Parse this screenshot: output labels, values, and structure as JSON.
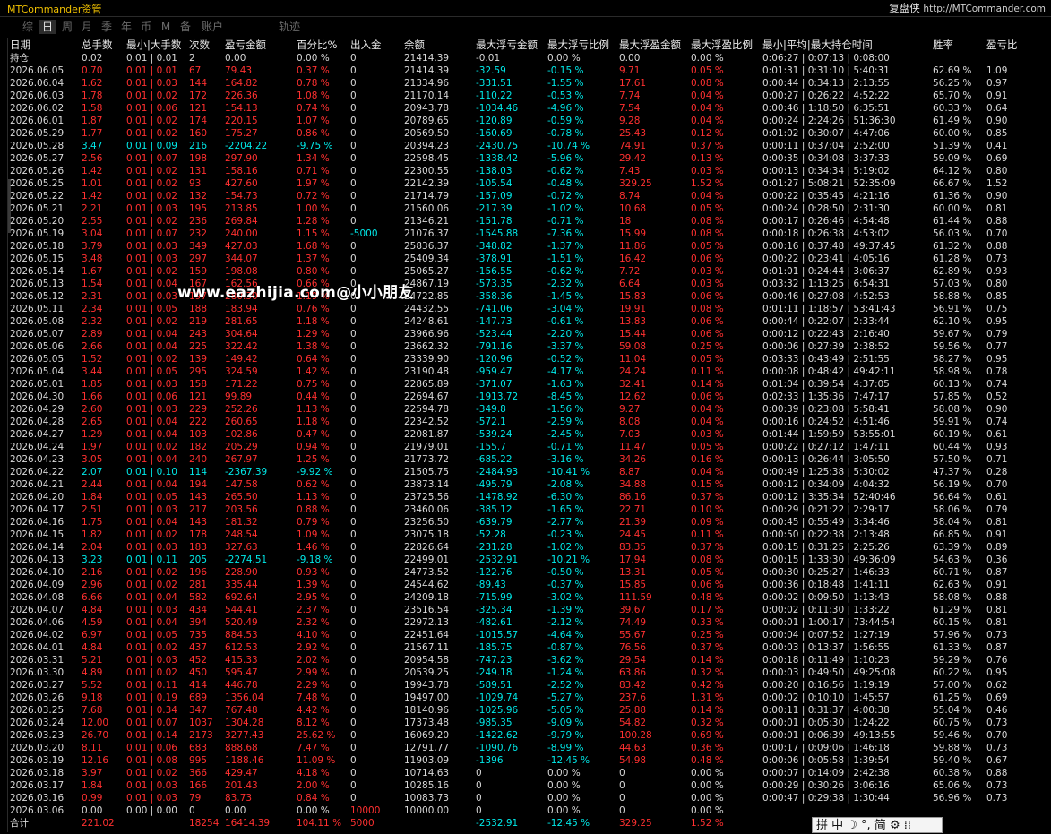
{
  "app": {
    "title": "MTCommander资管"
  },
  "brand": {
    "name": "复盘侠",
    "url": "http://MTCommander.com"
  },
  "tabs": [
    "综",
    "日",
    "周",
    "月",
    "季",
    "年",
    "币",
    "M",
    "备",
    "账户",
    "轨迹"
  ],
  "active_tab": "日",
  "headers": [
    "日期",
    "总手数",
    "最小|大手数",
    "次数",
    "盈亏金额",
    "百分比%",
    "出入金",
    "余额",
    "最大浮亏金额",
    "最大浮亏比例",
    "最大浮盈金额",
    "最大浮盈比例",
    "最小|平均|最大持仓时间",
    "胜率",
    "盈亏比"
  ],
  "holding": [
    "持仓",
    "0.02",
    "0.01 | 0.01",
    "2",
    "0.00",
    "0.00 %",
    "0",
    "21414.39",
    "-0.01",
    "0.00 %",
    "0.00",
    "0.00 %",
    "0:06:27 | 0:07:13 | 0:08:00",
    "",
    ""
  ],
  "rows": [
    [
      "2026.06.05",
      "0.70",
      "0.01 | 0.01",
      "67",
      "79.43",
      "0.37 %",
      "0",
      "21414.39",
      "-32.59",
      "-0.15 %",
      "9.71",
      "0.05 %",
      "0:01:31 | 0:31:10 | 5:40:31",
      "62.69 %",
      "1.09"
    ],
    [
      "2026.06.04",
      "1.62",
      "0.01 | 0.03",
      "144",
      "164.82",
      "0.78 %",
      "0",
      "21334.96",
      "-331.51",
      "-1.55 %",
      "17.61",
      "0.08 %",
      "0:00:44 | 0:34:13 | 2:13:55",
      "56.25 %",
      "0.97"
    ],
    [
      "2026.06.03",
      "1.78",
      "0.01 | 0.02",
      "172",
      "226.36",
      "1.08 %",
      "0",
      "21170.14",
      "-110.22",
      "-0.53 %",
      "7.74",
      "0.04 %",
      "0:00:27 | 0:26:22 | 4:52:22",
      "65.70 %",
      "0.91"
    ],
    [
      "2026.06.02",
      "1.58",
      "0.01 | 0.06",
      "121",
      "154.13",
      "0.74 %",
      "0",
      "20943.78",
      "-1034.46",
      "-4.96 %",
      "7.54",
      "0.04 %",
      "0:00:46 | 1:18:50 | 6:35:51",
      "60.33 %",
      "0.64"
    ],
    [
      "2026.06.01",
      "1.87",
      "0.01 | 0.02",
      "174",
      "220.15",
      "1.07 %",
      "0",
      "20789.65",
      "-120.89",
      "-0.59 %",
      "9.28",
      "0.04 %",
      "0:00:24 | 2:24:26 | 51:36:30",
      "61.49 %",
      "0.90"
    ],
    [
      "2026.05.29",
      "1.77",
      "0.01 | 0.02",
      "160",
      "175.27",
      "0.86 %",
      "0",
      "20569.50",
      "-160.69",
      "-0.78 %",
      "25.43",
      "0.12 %",
      "0:01:02 | 0:30:07 | 4:47:06",
      "60.00 %",
      "0.85"
    ],
    [
      "2026.05.28",
      "3.47",
      "0.01 | 0.09",
      "216",
      "-2204.22",
      "-9.75 %",
      "0",
      "20394.23",
      "-2430.75",
      "-10.74 %",
      "74.91",
      "0.37 %",
      "0:00:11 | 0:37:04 | 2:52:00",
      "51.39 %",
      "0.41"
    ],
    [
      "2026.05.27",
      "2.56",
      "0.01 | 0.07",
      "198",
      "297.90",
      "1.34 %",
      "0",
      "22598.45",
      "-1338.42",
      "-5.96 %",
      "29.42",
      "0.13 %",
      "0:00:35 | 0:34:08 | 3:37:33",
      "59.09 %",
      "0.69"
    ],
    [
      "2026.05.26",
      "1.42",
      "0.01 | 0.02",
      "131",
      "158.16",
      "0.71 %",
      "0",
      "22300.55",
      "-138.03",
      "-0.62 %",
      "7.43",
      "0.03 %",
      "0:00:13 | 0:34:34 | 5:19:02",
      "64.12 %",
      "0.80"
    ],
    [
      "2026.05.25",
      "1.01",
      "0.01 | 0.02",
      "93",
      "427.60",
      "1.97 %",
      "0",
      "22142.39",
      "-105.54",
      "-0.48 %",
      "329.25",
      "1.52 %",
      "0:01:27 | 5:08:21 | 52:35:09",
      "66.67 %",
      "1.52"
    ],
    [
      "2026.05.22",
      "1.42",
      "0.01 | 0.02",
      "132",
      "154.73",
      "0.72 %",
      "0",
      "21714.79",
      "-157.09",
      "-0.72 %",
      "8.74",
      "0.04 %",
      "0:00:22 | 0:35:45 | 4:21:16",
      "61.36 %",
      "0.90"
    ],
    [
      "2026.05.21",
      "2.21",
      "0.01 | 0.03",
      "195",
      "213.85",
      "1.00 %",
      "0",
      "21560.06",
      "-217.39",
      "-1.02 %",
      "10.68",
      "0.05 %",
      "0:00:24 | 0:28:50 | 2:31:30",
      "60.00 %",
      "0.81"
    ],
    [
      "2026.05.20",
      "2.55",
      "0.01 | 0.02",
      "236",
      "269.84",
      "1.28 %",
      "0",
      "21346.21",
      "-151.78",
      "-0.71 %",
      "18",
      "0.08 %",
      "0:00:17 | 0:26:46 | 4:54:48",
      "61.44 %",
      "0.88"
    ],
    [
      "2026.05.19",
      "3.04",
      "0.01 | 0.07",
      "232",
      "240.00",
      "1.15 %",
      "-5000",
      "21076.37",
      "-1545.88",
      "-7.36 %",
      "15.99",
      "0.08 %",
      "0:00:18 | 0:26:38 | 4:53:02",
      "56.03 %",
      "0.70"
    ],
    [
      "2026.05.18",
      "3.79",
      "0.01 | 0.03",
      "349",
      "427.03",
      "1.68 %",
      "0",
      "25836.37",
      "-348.82",
      "-1.37 %",
      "11.86",
      "0.05 %",
      "0:00:16 | 0:37:48 | 49:37:45",
      "61.32 %",
      "0.88"
    ],
    [
      "2026.05.15",
      "3.48",
      "0.01 | 0.03",
      "297",
      "344.07",
      "1.37 %",
      "0",
      "25409.34",
      "-378.91",
      "-1.51 %",
      "16.42",
      "0.06 %",
      "0:00:22 | 0:23:41 | 4:05:16",
      "61.28 %",
      "0.73"
    ],
    [
      "2026.05.14",
      "1.67",
      "0.01 | 0.02",
      "159",
      "198.08",
      "0.80 %",
      "0",
      "25065.27",
      "-156.55",
      "-0.62 %",
      "7.72",
      "0.03 %",
      "0:01:01 | 0:24:44 | 3:06:37",
      "62.89 %",
      "0.93"
    ],
    [
      "2026.05.13",
      "1.54",
      "0.01 | 0.04",
      "167",
      "162.56",
      "0.66 %",
      "0",
      "24867.19",
      "-573.35",
      "-2.32 %",
      "6.64",
      "0.03 %",
      "0:03:32 | 1:13:25 | 6:54:31",
      "57.03 %",
      "0.80"
    ],
    [
      "2026.05.12",
      "2.31",
      "0.01 | 0.03",
      "197",
      "280.30",
      "1.19 %",
      "0",
      "24722.85",
      "-358.36",
      "-1.45 %",
      "15.83",
      "0.06 %",
      "0:00:46 | 0:27:08 | 4:52:53",
      "58.88 %",
      "0.85"
    ],
    [
      "2026.05.11",
      "2.34",
      "0.01 | 0.05",
      "188",
      "183.94",
      "0.76 %",
      "0",
      "24432.55",
      "-741.06",
      "-3.04 %",
      "19.91",
      "0.08 %",
      "0:01:11 | 1:18:57 | 53:41:43",
      "56.91 %",
      "0.75"
    ],
    [
      "2026.05.08",
      "2.32",
      "0.01 | 0.02",
      "219",
      "281.65",
      "1.18 %",
      "0",
      "24248.61",
      "-147.73",
      "-0.61 %",
      "13.83",
      "0.06 %",
      "0:00:44 | 0:22:07 | 2:33:44",
      "62.10 %",
      "0.95"
    ],
    [
      "2026.05.07",
      "2.89",
      "0.01 | 0.04",
      "243",
      "304.64",
      "1.29 %",
      "0",
      "23966.96",
      "-523.44",
      "-2.20 %",
      "15.44",
      "0.06 %",
      "0:00:12 | 0:22:43 | 2:16:40",
      "59.67 %",
      "0.79"
    ],
    [
      "2026.05.06",
      "2.66",
      "0.01 | 0.04",
      "225",
      "322.42",
      "1.38 %",
      "0",
      "23662.32",
      "-791.16",
      "-3.37 %",
      "59.08",
      "0.25 %",
      "0:00:06 | 0:27:39 | 2:38:52",
      "59.56 %",
      "0.77"
    ],
    [
      "2026.05.05",
      "1.52",
      "0.01 | 0.02",
      "139",
      "149.42",
      "0.64 %",
      "0",
      "23339.90",
      "-120.96",
      "-0.52 %",
      "11.04",
      "0.05 %",
      "0:03:33 | 0:43:49 | 2:51:55",
      "58.27 %",
      "0.95"
    ],
    [
      "2026.05.04",
      "3.44",
      "0.01 | 0.05",
      "295",
      "324.59",
      "1.42 %",
      "0",
      "23190.48",
      "-959.47",
      "-4.17 %",
      "24.24",
      "0.11 %",
      "0:00:08 | 0:48:42 | 49:42:11",
      "58.98 %",
      "0.78"
    ],
    [
      "2026.05.01",
      "1.85",
      "0.01 | 0.03",
      "158",
      "171.22",
      "0.75 %",
      "0",
      "22865.89",
      "-371.07",
      "-1.63 %",
      "32.41",
      "0.14 %",
      "0:01:04 | 0:39:54 | 4:37:05",
      "60.13 %",
      "0.74"
    ],
    [
      "2026.04.30",
      "1.66",
      "0.01 | 0.06",
      "121",
      "99.89",
      "0.44 %",
      "0",
      "22694.67",
      "-1913.72",
      "-8.45 %",
      "12.62",
      "0.06 %",
      "0:02:33 | 1:35:36 | 7:47:17",
      "57.85 %",
      "0.52"
    ],
    [
      "2026.04.29",
      "2.60",
      "0.01 | 0.03",
      "229",
      "252.26",
      "1.13 %",
      "0",
      "22594.78",
      "-349.8",
      "-1.56 %",
      "9.27",
      "0.04 %",
      "0:00:39 | 0:23:08 | 5:58:41",
      "58.08 %",
      "0.90"
    ],
    [
      "2026.04.28",
      "2.65",
      "0.01 | 0.04",
      "222",
      "260.65",
      "1.18 %",
      "0",
      "22342.52",
      "-572.1",
      "-2.59 %",
      "8.08",
      "0.04 %",
      "0:00:16 | 0:24:52 | 4:51:46",
      "59.91 %",
      "0.74"
    ],
    [
      "2026.04.27",
      "1.29",
      "0.01 | 0.04",
      "103",
      "102.86",
      "0.47 %",
      "0",
      "22081.87",
      "-539.24",
      "-2.45 %",
      "7.03",
      "0.03 %",
      "0:01:44 | 1:59:59 | 53:55:01",
      "60.19 %",
      "0.61"
    ],
    [
      "2026.04.24",
      "1.97",
      "0.01 | 0.02",
      "182",
      "205.29",
      "0.94 %",
      "0",
      "21979.01",
      "-155.7",
      "-0.71 %",
      "11.47",
      "0.05 %",
      "0:00:22 | 0:27:12 | 1:47:11",
      "60.44 %",
      "0.93"
    ],
    [
      "2026.04.23",
      "3.05",
      "0.01 | 0.04",
      "240",
      "267.97",
      "1.25 %",
      "0",
      "21773.72",
      "-685.22",
      "-3.16 %",
      "34.26",
      "0.16 %",
      "0:00:13 | 0:26:44 | 3:05:50",
      "57.50 %",
      "0.71"
    ],
    [
      "2026.04.22",
      "2.07",
      "0.01 | 0.10",
      "114",
      "-2367.39",
      "-9.92 %",
      "0",
      "21505.75",
      "-2484.93",
      "-10.41 %",
      "8.87",
      "0.04 %",
      "0:00:49 | 1:25:38 | 5:30:02",
      "47.37 %",
      "0.28"
    ],
    [
      "2026.04.21",
      "2.44",
      "0.01 | 0.04",
      "194",
      "147.58",
      "0.62 %",
      "0",
      "23873.14",
      "-495.79",
      "-2.08 %",
      "34.88",
      "0.15 %",
      "0:00:12 | 0:34:09 | 4:04:32",
      "56.19 %",
      "0.70"
    ],
    [
      "2026.04.20",
      "1.84",
      "0.01 | 0.05",
      "143",
      "265.50",
      "1.13 %",
      "0",
      "23725.56",
      "-1478.92",
      "-6.30 %",
      "86.16",
      "0.37 %",
      "0:00:12 | 3:35:34 | 52:40:46",
      "56.64 %",
      "0.61"
    ],
    [
      "2026.04.17",
      "2.51",
      "0.01 | 0.03",
      "217",
      "203.56",
      "0.88 %",
      "0",
      "23460.06",
      "-385.12",
      "-1.65 %",
      "22.71",
      "0.10 %",
      "0:00:29 | 0:21:22 | 2:29:17",
      "58.06 %",
      "0.79"
    ],
    [
      "2026.04.16",
      "1.75",
      "0.01 | 0.04",
      "143",
      "181.32",
      "0.79 %",
      "0",
      "23256.50",
      "-639.79",
      "-2.77 %",
      "21.39",
      "0.09 %",
      "0:00:45 | 0:55:49 | 3:34:46",
      "58.04 %",
      "0.81"
    ],
    [
      "2026.04.15",
      "1.82",
      "0.01 | 0.02",
      "178",
      "248.54",
      "1.09 %",
      "0",
      "23075.18",
      "-52.28",
      "-0.23 %",
      "24.45",
      "0.11 %",
      "0:00:50 | 0:22:38 | 2:13:48",
      "66.85 %",
      "0.91"
    ],
    [
      "2026.04.14",
      "2.04",
      "0.01 | 0.03",
      "183",
      "327.63",
      "1.46 %",
      "0",
      "22826.64",
      "-231.28",
      "-1.02 %",
      "83.35",
      "0.37 %",
      "0:00:15 | 0:31:25 | 2:25:26",
      "63.39 %",
      "0.89"
    ],
    [
      "2026.04.13",
      "3.23",
      "0.01 | 0.11",
      "205",
      "-2274.51",
      "-9.18 %",
      "0",
      "22499.01",
      "-2532.91",
      "-10.21 %",
      "17.94",
      "0.08 %",
      "0:00:15 | 1:33:30 | 49:36:09",
      "54.63 %",
      "0.36"
    ],
    [
      "2026.04.10",
      "2.16",
      "0.01 | 0.02",
      "196",
      "228.90",
      "0.93 %",
      "0",
      "24773.52",
      "-122.76",
      "-0.50 %",
      "13.31",
      "0.05 %",
      "0:00:30 | 0:25:27 | 1:46:33",
      "60.71 %",
      "0.87"
    ],
    [
      "2026.04.09",
      "2.96",
      "0.01 | 0.02",
      "281",
      "335.44",
      "1.39 %",
      "0",
      "24544.62",
      "-89.43",
      "-0.37 %",
      "15.85",
      "0.06 %",
      "0:00:36 | 0:18:48 | 1:41:11",
      "62.63 %",
      "0.91"
    ],
    [
      "2026.04.08",
      "6.66",
      "0.01 | 0.04",
      "582",
      "692.64",
      "2.95 %",
      "0",
      "24209.18",
      "-715.99",
      "-3.02 %",
      "111.59",
      "0.48 %",
      "0:00:02 | 0:09:50 | 1:13:43",
      "58.08 %",
      "0.88"
    ],
    [
      "2026.04.07",
      "4.84",
      "0.01 | 0.03",
      "434",
      "544.41",
      "2.37 %",
      "0",
      "23516.54",
      "-325.34",
      "-1.39 %",
      "39.67",
      "0.17 %",
      "0:00:02 | 0:11:30 | 1:33:22",
      "61.29 %",
      "0.81"
    ],
    [
      "2026.04.06",
      "4.59",
      "0.01 | 0.04",
      "394",
      "520.49",
      "2.32 %",
      "0",
      "22972.13",
      "-482.61",
      "-2.12 %",
      "74.49",
      "0.33 %",
      "0:00:01 | 1:00:17 | 73:44:54",
      "60.15 %",
      "0.81"
    ],
    [
      "2026.04.02",
      "6.97",
      "0.01 | 0.05",
      "735",
      "884.53",
      "4.10 %",
      "0",
      "22451.64",
      "-1015.57",
      "-4.64 %",
      "55.67",
      "0.25 %",
      "0:00:04 | 0:07:52 | 1:27:19",
      "57.96 %",
      "0.73"
    ],
    [
      "2026.04.01",
      "4.84",
      "0.01 | 0.02",
      "437",
      "612.53",
      "2.92 %",
      "0",
      "21567.11",
      "-185.75",
      "-0.87 %",
      "76.56",
      "0.37 %",
      "0:00:03 | 0:13:37 | 1:56:55",
      "61.33 %",
      "0.87"
    ],
    [
      "2026.03.31",
      "5.21",
      "0.01 | 0.03",
      "452",
      "415.33",
      "2.02 %",
      "0",
      "20954.58",
      "-747.23",
      "-3.62 %",
      "29.54",
      "0.14 %",
      "0:00:18 | 0:11:49 | 1:10:23",
      "59.29 %",
      "0.76"
    ],
    [
      "2026.03.30",
      "4.89",
      "0.01 | 0.02",
      "450",
      "595.47",
      "2.99 %",
      "0",
      "20539.25",
      "-249.18",
      "-1.24 %",
      "63.86",
      "0.32 %",
      "0:00:03 | 0:49:50 | 49:25:08",
      "60.22 %",
      "0.95"
    ],
    [
      "2026.03.27",
      "5.52",
      "0.01 | 0.11",
      "414",
      "446.78",
      "2.29 %",
      "0",
      "19943.78",
      "-589.51",
      "-2.52 %",
      "83.42",
      "0.42 %",
      "0:00:20 | 0:16:56 | 1:19:19",
      "57.00 %",
      "0.62"
    ],
    [
      "2026.03.26",
      "9.18",
      "0.01 | 0.19",
      "689",
      "1356.04",
      "7.48 %",
      "0",
      "19497.00",
      "-1029.74",
      "-5.27 %",
      "237.6",
      "1.31 %",
      "0:00:02 | 0:10:10 | 1:45:57",
      "61.25 %",
      "0.69"
    ],
    [
      "2026.03.25",
      "7.68",
      "0.01 | 0.34",
      "347",
      "767.48",
      "4.42 %",
      "0",
      "18140.96",
      "-1025.96",
      "-5.05 %",
      "25.88",
      "0.14 %",
      "0:00:11 | 0:31:37 | 4:00:38",
      "55.04 %",
      "0.46"
    ],
    [
      "2026.03.24",
      "12.00",
      "0.01 | 0.07",
      "1037",
      "1304.28",
      "8.12 %",
      "0",
      "17373.48",
      "-985.35",
      "-9.09 %",
      "54.82",
      "0.32 %",
      "0:00:01 | 0:05:30 | 1:24:22",
      "60.75 %",
      "0.73"
    ],
    [
      "2026.03.23",
      "26.70",
      "0.01 | 0.14",
      "2173",
      "3277.43",
      "25.62 %",
      "0",
      "16069.20",
      "-1422.62",
      "-9.79 %",
      "100.28",
      "0.69 %",
      "0:00:01 | 0:06:39 | 49:13:55",
      "59.46 %",
      "0.70"
    ],
    [
      "2026.03.20",
      "8.11",
      "0.01 | 0.06",
      "683",
      "888.68",
      "7.47 %",
      "0",
      "12791.77",
      "-1090.76",
      "-8.99 %",
      "44.63",
      "0.36 %",
      "0:00:17 | 0:09:06 | 1:46:18",
      "59.88 %",
      "0.73"
    ],
    [
      "2026.03.19",
      "12.16",
      "0.01 | 0.08",
      "995",
      "1188.46",
      "11.09 %",
      "0",
      "11903.09",
      "-1396",
      "-12.45 %",
      "54.98",
      "0.48 %",
      "0:00:06 | 0:05:58 | 1:39:54",
      "59.40 %",
      "0.67"
    ],
    [
      "2026.03.18",
      "3.97",
      "0.01 | 0.02",
      "366",
      "429.47",
      "4.18 %",
      "0",
      "10714.63",
      "0",
      "0.00 %",
      "0",
      "0.00 %",
      "0:00:07 | 0:14:09 | 2:42:38",
      "60.38 %",
      "0.88"
    ],
    [
      "2026.03.17",
      "1.84",
      "0.01 | 0.03",
      "166",
      "201.43",
      "2.00 %",
      "0",
      "10285.16",
      "0",
      "0.00 %",
      "0",
      "0.00 %",
      "0:00:29 | 0:30:26 | 3:06:16",
      "65.06 %",
      "0.73"
    ],
    [
      "2026.03.16",
      "0.99",
      "0.01 | 0.03",
      "79",
      "83.73",
      "0.84 %",
      "0",
      "10083.73",
      "0",
      "0.00 %",
      "0",
      "0.00 %",
      "0:00:47 | 0:29:38 | 1:30:44",
      "56.96 %",
      "0.73"
    ],
    [
      "2026.03.06",
      "0.00",
      "0.00 | 0.00",
      "0",
      "0.00",
      "0.00 %",
      "10000",
      "10000.00",
      "0",
      "0.00 %",
      "0",
      "0.00 %",
      "",
      "",
      ""
    ]
  ],
  "total": [
    "合计",
    "221.02",
    "",
    "18254",
    "16414.39",
    "104.11 %",
    "5000",
    "",
    "-2532.91",
    "-12.45 %",
    "329.25",
    "1.52 %",
    "",
    "",
    ""
  ],
  "watermark": "www.eazhijia.com@小小朋友",
  "ime": {
    "text": "拼 中 ☽ °, 简 ⚙ ⁞⁞"
  }
}
